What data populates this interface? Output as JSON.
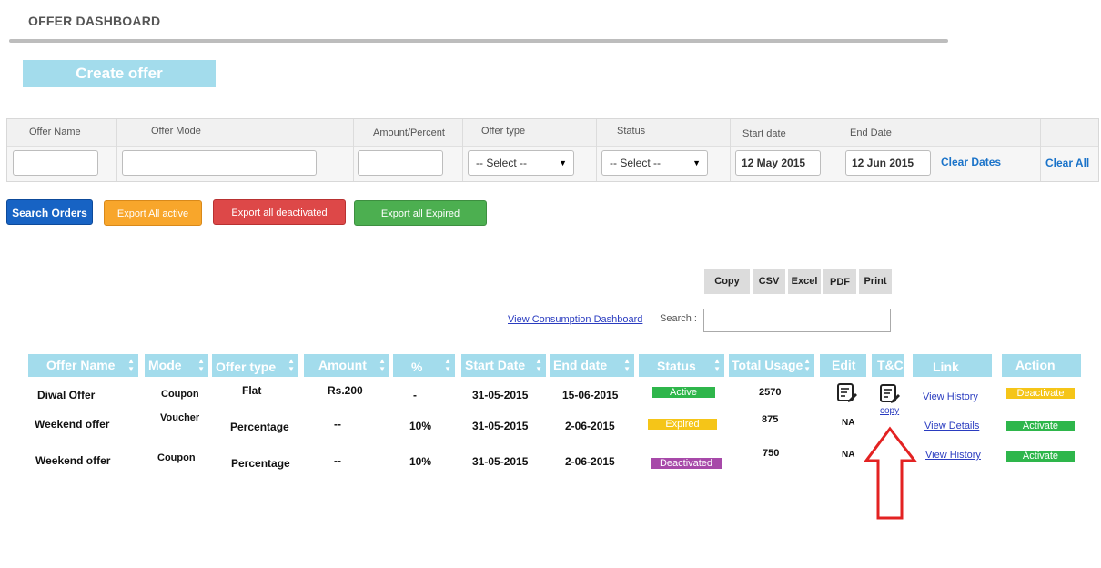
{
  "page": {
    "title": "OFFER DASHBOARD",
    "create_button": "Create offer"
  },
  "filters": {
    "labels": {
      "offer_name": "Offer Name",
      "offer_mode": "Offer Mode",
      "amount_percent": "Amount/Percent",
      "offer_type": "Offer type",
      "status": "Status",
      "start_date": "Start date",
      "end_date": "End Date"
    },
    "offer_type_select": "-- Select --",
    "status_select": "-- Select --",
    "start_date_value": "12 May 2015",
    "end_date_value": "12 Jun 2015",
    "clear_dates": "Clear Dates",
    "clear_all": "Clear All"
  },
  "actions": {
    "search": "Search Orders",
    "export_active": "Export All active",
    "export_deactivated": "Export all deactivated",
    "export_expired": "Export all  Expired"
  },
  "table_tools": {
    "copy": "Copy",
    "csv": "CSV",
    "excel": "Excel",
    "pdf": "PDF",
    "print": "Print",
    "consumption_link": "View Consumption Dashboard",
    "search_label": "Search :"
  },
  "columns": [
    "Offer Name",
    "Mode",
    "Offer type",
    "Amount",
    "%",
    "Start Date",
    "End date",
    "Status",
    "Total Usage",
    "Edit",
    "T&C",
    "Link",
    "Action"
  ],
  "rows": [
    {
      "name": "Diwal Offer",
      "mode": "Coupon",
      "type": "Flat",
      "amount": "Rs.200",
      "percent": "-",
      "start": "31-05-2015",
      "end": "15-06-2015",
      "status": "Active",
      "usage": "2570",
      "link": "View History",
      "action": "Deactivate"
    },
    {
      "name": "Weekend offer",
      "mode": "Voucher",
      "type": "Percentage",
      "amount": "--",
      "percent": "10%",
      "start": "31-05-2015",
      "end": "2-06-2015",
      "status": "Expired",
      "usage": "875",
      "edit": "NA",
      "link": "View Details",
      "action": "Activate"
    },
    {
      "name": "Weekend offer",
      "mode": "Coupon",
      "type": "Percentage",
      "amount": "--",
      "percent": "10%",
      "start": "31-05-2015",
      "end": "2-06-2015",
      "status": "Deactivated",
      "usage": "750",
      "edit": "NA",
      "link": "View History",
      "action": "Activate"
    }
  ],
  "tc_copy_label": "copy",
  "colors": {
    "header": "#a3dcec",
    "active": "#2eb64b",
    "expired": "#f5c518",
    "deactivated": "#a749a9",
    "arrow": "#e32222"
  },
  "icons": [
    "edit-note-icon",
    "sort-icon",
    "chevron-down-icon",
    "arrow-up-icon"
  ]
}
